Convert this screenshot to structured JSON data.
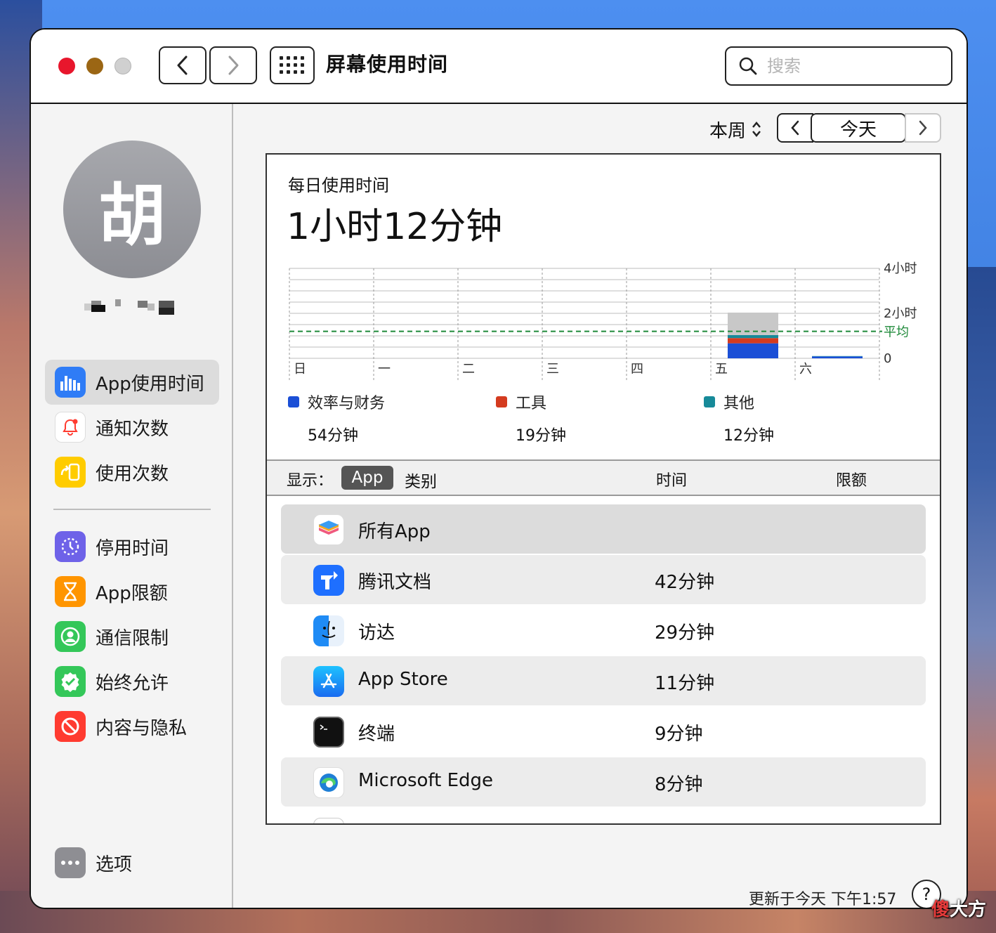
{
  "window": {
    "title": "屏幕使用时间",
    "search_placeholder": "搜索"
  },
  "user": {
    "avatar_initial": "胡"
  },
  "sidebar": {
    "items": [
      {
        "label": "App使用时间",
        "icon": "bar-chart-icon",
        "color": "#2f7cf6",
        "active": true
      },
      {
        "label": "通知次数",
        "icon": "bell-icon",
        "color": "#ffffff"
      },
      {
        "label": "使用次数",
        "icon": "pickup-icon",
        "color": "#ffcc00"
      },
      {
        "label": "停用时间",
        "icon": "downtime-icon",
        "color": "#6e62e8"
      },
      {
        "label": "App限额",
        "icon": "hourglass-icon",
        "color": "#ff9500"
      },
      {
        "label": "通信限制",
        "icon": "contact-icon",
        "color": "#34c759"
      },
      {
        "label": "始终允许",
        "icon": "checkmark-badge-icon",
        "color": "#34c759"
      },
      {
        "label": "内容与隐私",
        "icon": "restrict-icon",
        "color": "#ff3b30"
      }
    ],
    "options_label": "选项"
  },
  "header": {
    "period": "本周",
    "today": "今天"
  },
  "summary": {
    "label": "每日使用时间",
    "value": "1小时12分钟"
  },
  "chart_data": {
    "type": "bar",
    "stacked": true,
    "categories": [
      "日",
      "一",
      "二",
      "三",
      "四",
      "五",
      "六"
    ],
    "y_ticks": [
      "4小时",
      "2小时",
      "0"
    ],
    "ylim_minutes": [
      0,
      240
    ],
    "average_label": "平均",
    "average_minutes": 72,
    "series": [
      {
        "name": "效率与财务",
        "color": "#1b4fd6",
        "values": [
          0,
          0,
          0,
          0,
          0,
          40,
          5
        ]
      },
      {
        "name": "工具",
        "color": "#d43b1f",
        "values": [
          0,
          0,
          0,
          0,
          0,
          14,
          0
        ]
      },
      {
        "name": "其他",
        "color": "#178a99",
        "values": [
          0,
          0,
          0,
          0,
          0,
          8,
          1
        ]
      },
      {
        "color": "#c8c8c8",
        "values": [
          0,
          0,
          0,
          0,
          0,
          60,
          0
        ]
      }
    ],
    "grid": true
  },
  "legend": [
    {
      "name": "效率与财务",
      "value": "54分钟",
      "color": "#1b4fd6"
    },
    {
      "name": "工具",
      "value": "19分钟",
      "color": "#d43b1f"
    },
    {
      "name": "其他",
      "value": "12分钟",
      "color": "#178a99"
    }
  ],
  "list": {
    "show_label": "显示：",
    "segments": [
      "App",
      "类别"
    ],
    "col_time": "时间",
    "col_limit": "限额",
    "rows": [
      {
        "name": "所有App",
        "time": "",
        "icon": "stack-icon"
      },
      {
        "name": "腾讯文档",
        "time": "42分钟",
        "icon": "tencent-docs-icon"
      },
      {
        "name": "访达",
        "time": "29分钟",
        "icon": "finder-icon"
      },
      {
        "name": "App Store",
        "time": "11分钟",
        "icon": "app-store-icon"
      },
      {
        "name": "终端",
        "time": "9分钟",
        "icon": "terminal-icon"
      },
      {
        "name": "Microsoft Edge",
        "time": "8分钟",
        "icon": "edge-icon"
      }
    ]
  },
  "footer": {
    "updated": "更新于今天 下午1:57",
    "help": "?"
  },
  "watermark": {
    "first": "傻",
    "rest": "大方"
  }
}
